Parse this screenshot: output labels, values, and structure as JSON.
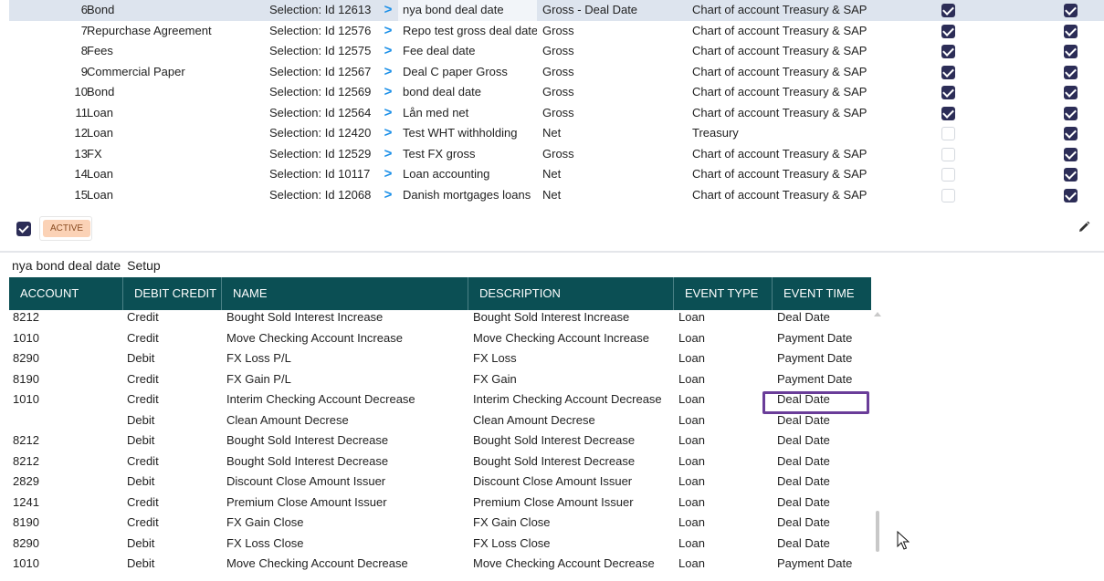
{
  "top_grid": {
    "rows": [
      {
        "num": "6",
        "type": "Bond",
        "selection": "Selection: Id 12613",
        "name": "nya bond deal date",
        "calc": "Gross - Deal Date",
        "chart": "Chart of account Treasury & SAP",
        "check_a": true,
        "check_b": true,
        "selected": true
      },
      {
        "num": "7",
        "type": "Repurchase Agreement",
        "selection": "Selection: Id 12576",
        "name": "Repo test gross deal date",
        "calc": "Gross",
        "chart": "Chart of account Treasury & SAP",
        "check_a": true,
        "check_b": true,
        "selected": false
      },
      {
        "num": "8",
        "type": "Fees",
        "selection": "Selection: Id 12575",
        "name": "Fee deal date",
        "calc": "Gross",
        "chart": "Chart of account Treasury & SAP",
        "check_a": true,
        "check_b": true,
        "selected": false
      },
      {
        "num": "9",
        "type": "Commercial Paper",
        "selection": "Selection: Id 12567",
        "name": "Deal C paper Gross",
        "calc": "Gross",
        "chart": "Chart of account Treasury & SAP",
        "check_a": true,
        "check_b": true,
        "selected": false
      },
      {
        "num": "10",
        "type": "Bond",
        "selection": "Selection: Id 12569",
        "name": "bond deal date",
        "calc": "Gross",
        "chart": "Chart of account Treasury & SAP",
        "check_a": true,
        "check_b": true,
        "selected": false
      },
      {
        "num": "11",
        "type": "Loan",
        "selection": "Selection: Id 12564",
        "name": "Lån med net",
        "calc": "Gross",
        "chart": "Chart of account Treasury & SAP",
        "check_a": true,
        "check_b": true,
        "selected": false
      },
      {
        "num": "12",
        "type": "Loan",
        "selection": "Selection: Id 12420",
        "name": "Test WHT withholding",
        "calc": "Net",
        "chart": "Treasury",
        "check_a": false,
        "check_b": true,
        "selected": false
      },
      {
        "num": "13",
        "type": "FX",
        "selection": "Selection: Id 12529",
        "name": "Test FX gross",
        "calc": "Gross",
        "chart": "Chart of account Treasury & SAP",
        "check_a": false,
        "check_b": true,
        "selected": false
      },
      {
        "num": "14",
        "type": "Loan",
        "selection": "Selection: Id 10117",
        "name": "Loan accounting",
        "calc": "Net",
        "chart": "Chart of account Treasury & SAP",
        "check_a": false,
        "check_b": true,
        "selected": false
      },
      {
        "num": "15",
        "type": "Loan",
        "selection": "Selection: Id 12068",
        "name": "Danish mortgages loans",
        "calc": "Net",
        "chart": "Chart of account Treasury & SAP",
        "check_a": false,
        "check_b": true,
        "selected": false
      }
    ],
    "arrow_glyph": ">"
  },
  "toolbar": {
    "status_badge": "ACTIVE",
    "edit_icon": "pencil-icon"
  },
  "setup": {
    "title_name": "nya bond deal date",
    "title_suffix": "Setup"
  },
  "bottom_grid": {
    "headers": {
      "account": "ACCOUNT",
      "debit_credit": "DEBIT CREDIT",
      "name": "NAME",
      "description": "DESCRIPTION",
      "event_type": "EVENT TYPE",
      "event_time": "EVENT TIME"
    },
    "rows": [
      {
        "account": "8212",
        "dc": "Credit",
        "name": "Bought Sold Interest Increase",
        "desc": "Bought Sold Interest Increase",
        "etype": "Loan",
        "etime": "Deal Date"
      },
      {
        "account": "1010",
        "dc": "Credit",
        "name": "Move Checking Account Increase",
        "desc": "Move Checking Account Increase",
        "etype": "Loan",
        "etime": "Payment Date"
      },
      {
        "account": "8290",
        "dc": "Debit",
        "name": "FX Loss P/L",
        "desc": "FX Loss",
        "etype": "Loan",
        "etime": "Payment Date"
      },
      {
        "account": "8190",
        "dc": "Credit",
        "name": "FX Gain P/L",
        "desc": "FX Gain",
        "etype": "Loan",
        "etime": "Payment Date"
      },
      {
        "account": "1010",
        "dc": "Credit",
        "name": "Interim Checking Account Decrease",
        "desc": "Interim Checking Account Decrease",
        "etype": "Loan",
        "etime": "Deal Date"
      },
      {
        "account": "",
        "dc": "Debit",
        "name": "Clean Amount Decrese",
        "desc": "Clean Amount Decrese",
        "etype": "Loan",
        "etime": "Deal Date"
      },
      {
        "account": "8212",
        "dc": "Debit",
        "name": "Bought Sold Interest Decrease",
        "desc": "Bought Sold Interest Decrease",
        "etype": "Loan",
        "etime": "Deal Date"
      },
      {
        "account": "8212",
        "dc": "Credit",
        "name": "Bought Sold Interest Decrease",
        "desc": "Bought Sold Interest Decrease",
        "etype": "Loan",
        "etime": "Deal Date"
      },
      {
        "account": "2829",
        "dc": "Debit",
        "name": "Discount Close Amount Issuer",
        "desc": "Discount Close Amount Issuer",
        "etype": "Loan",
        "etime": "Deal Date"
      },
      {
        "account": "1241",
        "dc": "Credit",
        "name": "Premium Close Amount Issuer",
        "desc": "Premium Close Amount Issuer",
        "etype": "Loan",
        "etime": "Deal Date"
      },
      {
        "account": "8190",
        "dc": "Credit",
        "name": "FX Gain Close",
        "desc": "FX Gain Close",
        "etype": "Loan",
        "etime": "Deal Date"
      },
      {
        "account": "8290",
        "dc": "Debit",
        "name": "FX Loss Close",
        "desc": "FX Loss Close",
        "etype": "Loan",
        "etime": "Deal Date"
      },
      {
        "account": "1010",
        "dc": "Debit",
        "name": "Move Checking Account Decrease",
        "desc": "Move Checking Account Decrease",
        "etype": "Loan",
        "etime": "Payment Date"
      }
    ]
  },
  "colors": {
    "header_bg": "#0b4f54",
    "checkbox_checked": "#2c2d57",
    "arrow": "#1a8fe8",
    "highlight": "#6a3d99",
    "badge_bg": "#fbd2b6"
  }
}
